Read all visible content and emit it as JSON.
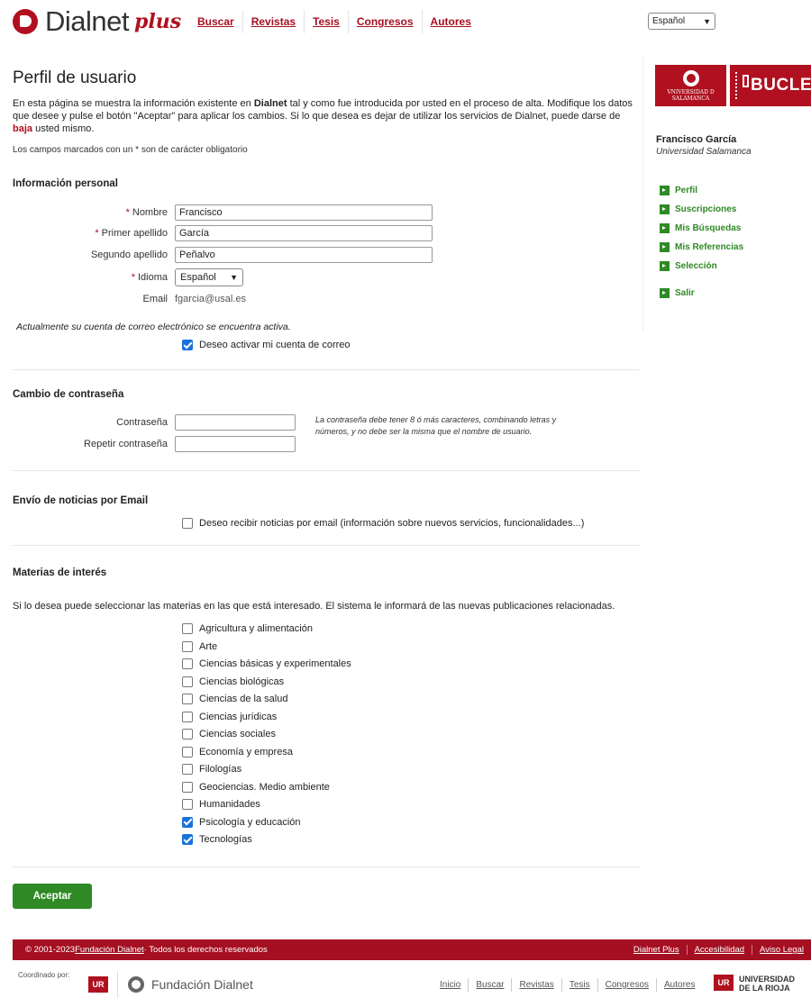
{
  "brand": {
    "name": "Dialnet",
    "plus": "plus"
  },
  "topnav": [
    "Buscar",
    "Revistas",
    "Tesis",
    "Congresos",
    "Autores"
  ],
  "language_select": {
    "value": "Español"
  },
  "page": {
    "title": "Perfil de usuario",
    "intro_part1": "En esta página se muestra la información existente en ",
    "intro_bold": "Dialnet",
    "intro_part2": " tal y como fue introducida por usted en el proceso de alta. Modifique los datos que desee y pulse el botón \"Aceptar\" para aplicar los cambios. Si lo que desea es dejar de utilizar los servicios de Dialnet, puede darse de ",
    "intro_link": "baja",
    "intro_part3": " usted mismo.",
    "required_note": "Los campos marcados con un * son de carácter obligatorio"
  },
  "personal": {
    "title": "Información personal",
    "nombre_label": "Nombre",
    "nombre_value": "Francisco",
    "apellido1_label": "Primer apellido",
    "apellido1_value": "García",
    "apellido2_label": "Segundo apellido",
    "apellido2_value": "Peñalvo",
    "idioma_label": "Idioma",
    "idioma_value": "Español",
    "email_label": "Email",
    "email_value": "fgarcia@usal.es",
    "account_note": "Actualmente su cuenta de correo electrónico se encuentra activa.",
    "activate_label": "Deseo activar mi cuenta de correo",
    "activate_checked": true
  },
  "password": {
    "title": "Cambio de contraseña",
    "pw_label": "Contraseña",
    "pw2_label": "Repetir contraseña",
    "hint": "La contraseña debe tener 8 ó más caracteres, combinando letras y números, y no debe ser la misma que el nombre de usuario."
  },
  "news": {
    "title": "Envío de noticias por Email",
    "label": "Deseo recibir noticias por email (información sobre nuevos servicios, funcionalidades...)",
    "checked": false
  },
  "topics": {
    "title": "Materias de interés",
    "intro": "Si lo desea puede seleccionar las materias en las que está interesado. El sistema le informará de las nuevas publicaciones relacionadas.",
    "items": [
      {
        "label": "Agricultura y alimentación",
        "checked": false
      },
      {
        "label": "Arte",
        "checked": false
      },
      {
        "label": "Ciencias básicas y experimentales",
        "checked": false
      },
      {
        "label": "Ciencias biológicas",
        "checked": false
      },
      {
        "label": "Ciencias de la salud",
        "checked": false
      },
      {
        "label": "Ciencias jurídicas",
        "checked": false
      },
      {
        "label": "Ciencias sociales",
        "checked": false
      },
      {
        "label": "Economía y empresa",
        "checked": false
      },
      {
        "label": "Filologías",
        "checked": false
      },
      {
        "label": "Geociencias. Medio ambiente",
        "checked": false
      },
      {
        "label": "Humanidades",
        "checked": false
      },
      {
        "label": "Psicología y educación",
        "checked": true
      },
      {
        "label": "Tecnologías",
        "checked": true
      }
    ]
  },
  "accept_label": "Aceptar",
  "sidebar": {
    "usal_text": "VNIVERSIDAD D SALAMANCA",
    "bucle_text": "BUCLE",
    "user_name": "Francisco García",
    "institution": "Universidad Salamanca",
    "menu": [
      "Perfil",
      "Suscripciones",
      "Mis Búsquedas",
      "Mis Referencias",
      "Selección"
    ],
    "logout": "Salir"
  },
  "footer": {
    "copyright_prefix": "© 2001-2023 ",
    "foundation_link": "Fundación Dialnet",
    "copyright_suffix": " · Todos los derechos reservados",
    "links": [
      "Dialnet Plus",
      "Accesibilidad",
      "Aviso Legal"
    ],
    "coordinated_by": "Coordinado por:",
    "foundation_logo": "Fundación Dialnet",
    "ur_mark": "UR",
    "bottom_nav": [
      "Inicio",
      "Buscar",
      "Revistas",
      "Tesis",
      "Congresos",
      "Autores"
    ],
    "university_line1": "UNIVERSIDAD",
    "university_line2": "DE LA RIOJA"
  },
  "colors": {
    "brand_red": "#a50f22",
    "green": "#2f8a25",
    "checkbox_blue": "#1a73d9"
  }
}
